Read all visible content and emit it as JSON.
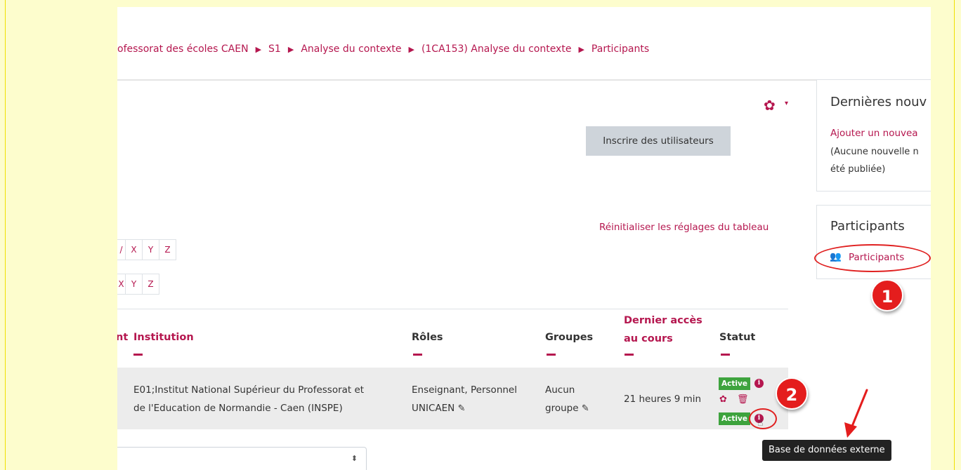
{
  "breadcrumb": {
    "items": [
      "ofessorat des écoles CAEN",
      "S1",
      "Analyse du contexte",
      "(1CA153) Analyse du contexte",
      "Participants"
    ],
    "separator": "▶"
  },
  "toolbar": {
    "gear_icon": "gear-icon",
    "enrol_button_label": "Inscrire des utilisateurs",
    "reset_link": "Réinitialiser les réglages du tableau"
  },
  "letter_filters": {
    "row1": [
      "/",
      "X",
      "Y",
      "Z"
    ],
    "row2": [
      "X",
      "Y",
      "Z"
    ]
  },
  "table": {
    "headers": {
      "partial": "nt",
      "institution": "Institution",
      "roles": "Rôles",
      "groups": "Groupes",
      "last_access_line1": "Dernier accès",
      "last_access_line2": "au cours",
      "status": "Statut"
    },
    "rows": [
      {
        "institution_line1": "E01;Institut National Supérieur du Professorat et",
        "institution_line2": "de l'Education de Normandie - Caen (INSPE)",
        "roles_line1": "Enseignant, Personnel",
        "roles_line2": "UNICAEN",
        "groups_line1": "Aucun",
        "groups_line2": "groupe",
        "last_access": "21 heures 9 min",
        "status_1": "Active",
        "status_2": "Active"
      }
    ]
  },
  "sidebar": {
    "news": {
      "title": "Dernières nouv",
      "link": "Ajouter un nouvea",
      "text_line1": "(Aucune nouvelle n",
      "text_line2": "été publiée)"
    },
    "participants": {
      "title": "Participants",
      "link": "Participants"
    }
  },
  "annotations": {
    "badge_1": "1",
    "badge_2": "2",
    "tooltip": "Base de données externe",
    "color": "#e41d1d"
  },
  "colors": {
    "accent": "#b5174f",
    "status_active": "#3da33d",
    "background": "#fdfdcd"
  }
}
